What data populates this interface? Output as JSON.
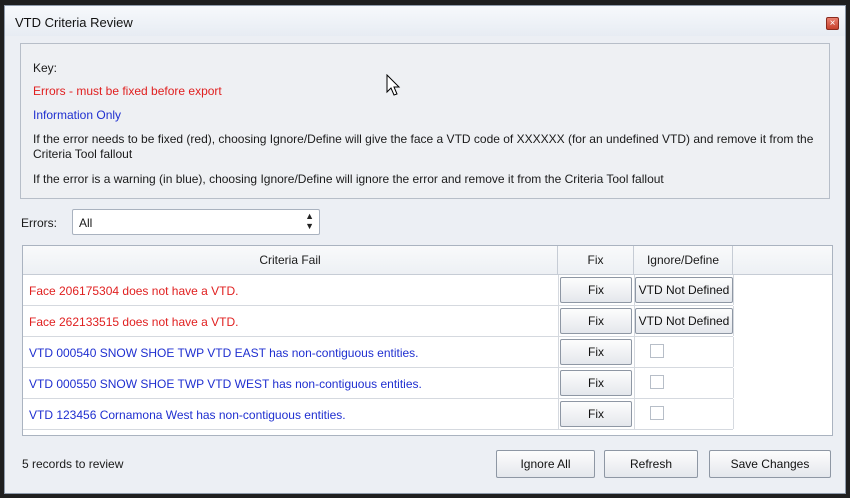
{
  "window": {
    "title": "VTD Criteria Review",
    "close_glyph": "×"
  },
  "key": {
    "title": "Key:",
    "error_line": "Errors - must be fixed before export",
    "info_line": "Information Only",
    "note1": "If the error needs to be fixed (red), choosing Ignore/Define will give the face a VTD code of XXXXXX (for an undefined VTD) and remove it from the Criteria Tool fallout",
    "note2": "If the error is a warning (in blue), choosing Ignore/Define will ignore the error and remove it from the Criteria Tool fallout"
  },
  "filter": {
    "label": "Errors:",
    "value": "All",
    "arrows_glyph": "▲\n▼"
  },
  "table": {
    "columns": [
      "Criteria Fail",
      "Fix",
      "Ignore/Define"
    ],
    "rows": [
      {
        "text": "Face 206175304 does not have a VTD.",
        "type": "error",
        "fix": "Fix",
        "ignore": "VTD Not Defined"
      },
      {
        "text": "Face 262133515 does not have a VTD.",
        "type": "error",
        "fix": "Fix",
        "ignore": "VTD Not Defined"
      },
      {
        "text": "VTD 000540 SNOW SHOE TWP VTD EAST has non-contiguous entities.",
        "type": "info",
        "fix": "Fix",
        "ignore": ""
      },
      {
        "text": "VTD 000550 SNOW SHOE TWP VTD WEST has non-contiguous entities.",
        "type": "info",
        "fix": "Fix",
        "ignore": ""
      },
      {
        "text": "VTD 123456 Cornamona West has non-contiguous entities.",
        "type": "info",
        "fix": "Fix",
        "ignore": ""
      }
    ]
  },
  "footer": {
    "records": "5  records to review",
    "ignore_all": "Ignore All",
    "refresh": "Refresh",
    "save": "Save Changes"
  },
  "colors": {
    "error": "#e02020",
    "info": "#1f2fd0"
  }
}
